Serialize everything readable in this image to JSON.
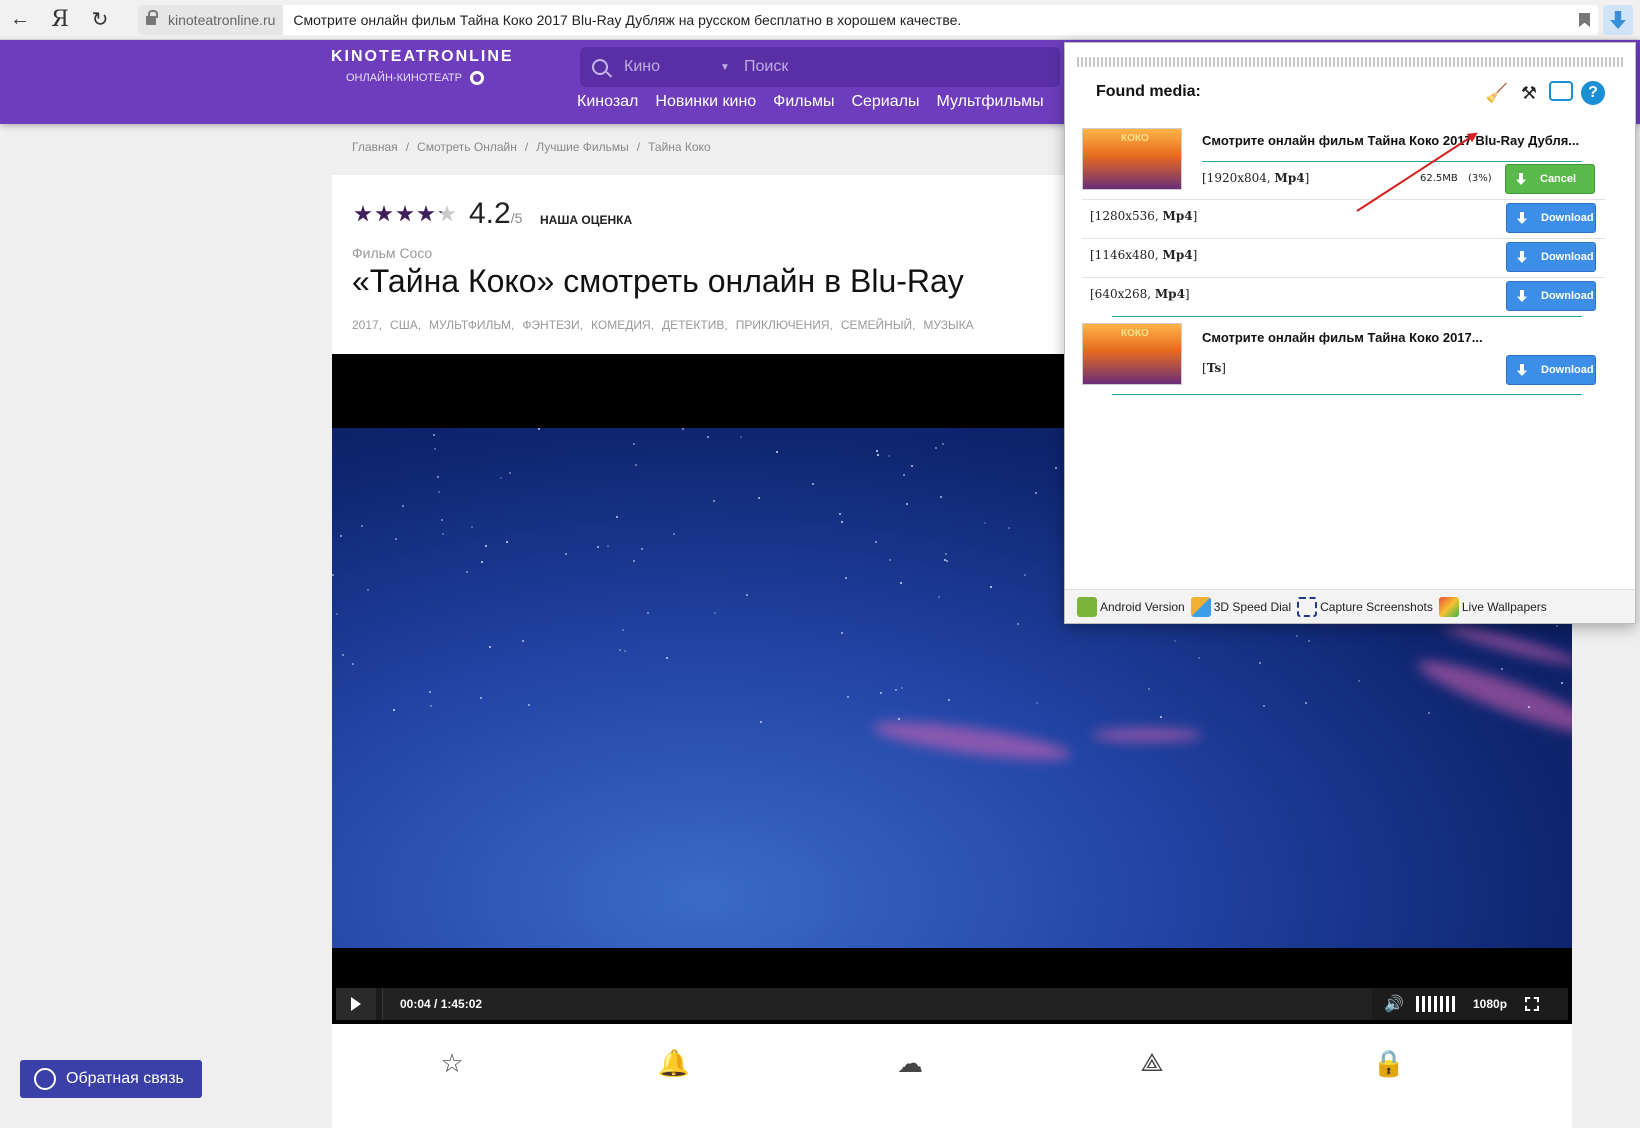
{
  "browser": {
    "back": "←",
    "yandex": "Я",
    "reload": "↻",
    "domain": "kinoteatronline.ru",
    "page_title": "Смотрите онлайн фильм Тайна Коко 2017 Blu-Ray Дубляж на русском бесплатно в хорошем качестве."
  },
  "site": {
    "logo": "KINOTEATRONLINE",
    "logo_sub": "ОНЛАЙН-КИНОТЕАТР",
    "search_category": "Кино",
    "search_placeholder": "Поиск",
    "nav": [
      "Кинозал",
      "Новинки кино",
      "Фильмы",
      "Сериалы",
      "Мультфильмы"
    ]
  },
  "breadcrumb": [
    "Главная",
    "/",
    "Смотреть Онлайн",
    "/",
    "Лучшие Фильмы",
    "/",
    "Тайна Коко"
  ],
  "movie": {
    "rating": "4.2",
    "rating_max": "/5",
    "rating_label": "НАША ОЦЕНКА",
    "stars_filled": 4.2,
    "original_title": "Фильм Coco",
    "title": "«Тайна Коко» смотреть онлайн в Blu-Ray",
    "tags": [
      "2017,",
      "США,",
      "МУЛЬТФИЛЬМ,",
      "ФЭНТЕЗИ,",
      "КОМЕДИЯ,",
      "ДЕТЕКТИВ,",
      "ПРИКЛЮЧЕНИЯ,",
      "СЕМЕЙНЫЙ,",
      "МУЗЫКА"
    ]
  },
  "player": {
    "time": "00:04 / 1:45:02",
    "progress": 0.0006,
    "quality": "1080p"
  },
  "feedback": "Обратная связь",
  "popup": {
    "heading": "Found media:",
    "items": [
      {
        "title": "Смотрите онлайн фильм Тайна Коко 2017 Blu-Ray Дубля...",
        "thumb_logo": "КОКО",
        "variants": [
          {
            "res": "[1920x804, ",
            "fmt": "Mp4",
            "end": "]",
            "size": "62.5MB",
            "pct": "(3%)",
            "button": "Cancel"
          },
          {
            "res": "[1280x536, ",
            "fmt": "Mp4",
            "end": "]",
            "button": "Download"
          },
          {
            "res": "[1146x480, ",
            "fmt": "Mp4",
            "end": "]",
            "button": "Download"
          },
          {
            "res": "[640x268, ",
            "fmt": "Mp4",
            "end": "]",
            "button": "Download"
          }
        ]
      },
      {
        "title": "Смотрите онлайн фильм Тайна Коко 2017...",
        "thumb_logo": "КОКО",
        "variants": [
          {
            "res": "[",
            "fmt": "Ts",
            "end": "]",
            "button": "Download"
          }
        ]
      }
    ],
    "footer": [
      "Android Version",
      "3D Speed Dial",
      "Capture Screenshots",
      "Live Wallpapers"
    ],
    "colors": {
      "download": "#3d8ee8",
      "cancel": "#59b94a",
      "accent": "#6d3dbd"
    }
  }
}
